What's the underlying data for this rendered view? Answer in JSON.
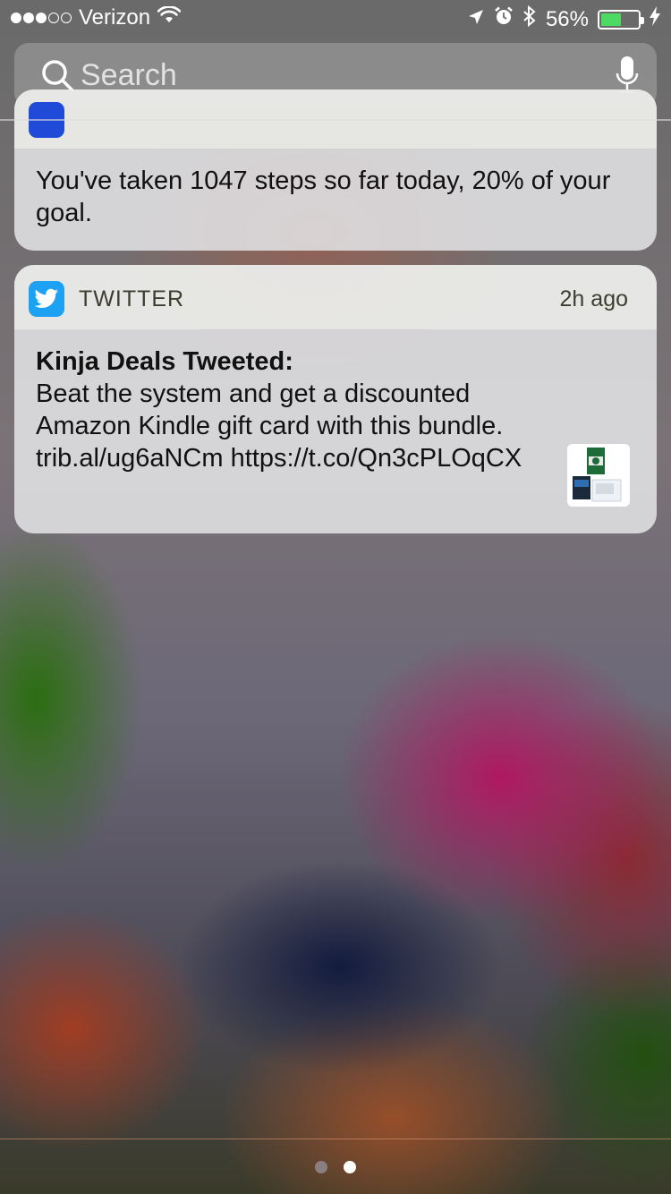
{
  "status_bar": {
    "carrier": "Verizon",
    "battery_percent": "56%",
    "battery_level": 0.56,
    "signal_bars_filled": 3,
    "signal_bars_total": 5
  },
  "search": {
    "placeholder": "Search"
  },
  "notifications": [
    {
      "body": "You've taken 1047 steps so far today, 20% of your goal."
    },
    {
      "app_name": "TWITTER",
      "time": "2h ago",
      "title": "Kinja Deals Tweeted:",
      "body": "Beat the system and get a discounted Amazon Kindle gift card with this bundle. trib.al/ug6aNCm https://t.co/Qn3cPLOqCX"
    }
  ],
  "page_indicator": {
    "pages": 2,
    "current": 2
  },
  "colors": {
    "twitter_blue": "#1da1f2",
    "battery_green": "#4cd964",
    "dot_active": "#ffffff",
    "dot_inactive": "#8a7f80"
  }
}
